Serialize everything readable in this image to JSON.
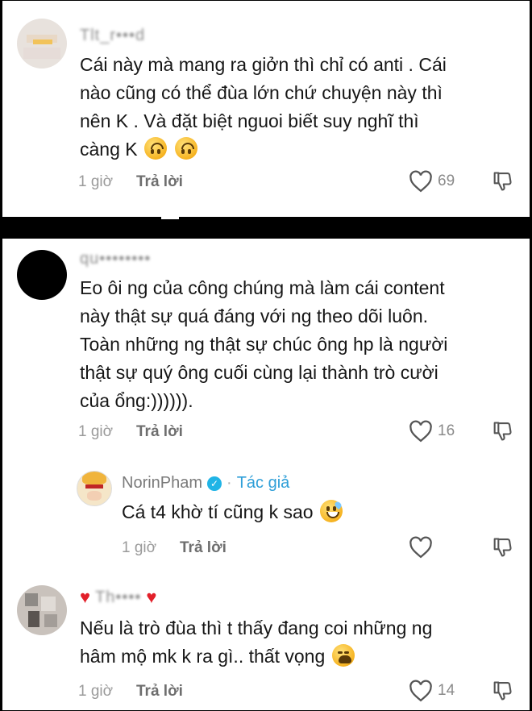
{
  "comments": [
    {
      "username": "Tlt_r•••d",
      "text": "Cái này mà mang ra giởn thì chỉ có anti . Cái\nnào cũng có thể đùa lớn chứ chuyện này thì\nnên K . Và đặt biệt nguoi biết suy nghĩ thì\ncàng K",
      "time": "1 giờ",
      "reply_label": "Trả lời",
      "likes": "69"
    },
    {
      "username": "qu••••••••",
      "text": "Eo ôi ng của công chúng mà làm cái content\nnày thật sự quá đáng với ng theo dõi luôn.\nToàn những ng thật sự chúc ông hp là người\nthật sự quý ông cuối cùng lại thành trò cười\ncủa ổng:)))))).",
      "time": "1 giờ",
      "reply_label": "Trả lời",
      "likes": "16",
      "reply": {
        "username": "NorinPham",
        "author_tag": "Tác giả",
        "text": "Cá t4 khờ tí cũng k sao",
        "time": "1 giờ",
        "reply_label": "Trả lời"
      }
    },
    {
      "username": "Th••••",
      "text": "Nếu là trò đùa thì t thấy đang coi những ng\nhâm mộ mk k ra gì.. thất vọng",
      "time": "1 giờ",
      "reply_label": "Trả lời",
      "likes": "14"
    }
  ],
  "colors": {
    "text": "#161616",
    "muted": "#9a9a9a",
    "author_tag": "#2f9fd8",
    "verified": "#20b4e6"
  },
  "icons": [
    "heart-outline-icon",
    "dislike-icon",
    "verified-badge-icon",
    "upside-down-face-emoji",
    "grinning-sweat-emoji",
    "weary-face-emoji",
    "red-heart-icon"
  ]
}
